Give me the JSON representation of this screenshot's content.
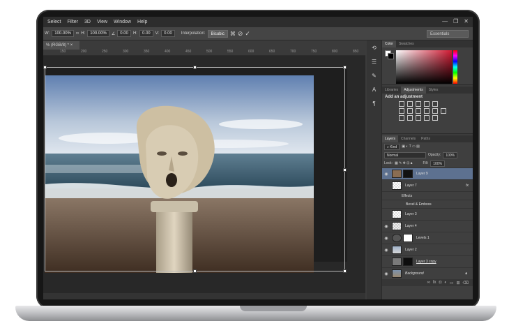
{
  "menubar": {
    "items": [
      "Select",
      "Filter",
      "3D",
      "View",
      "Window",
      "Help"
    ],
    "window_controls": [
      "—",
      "❐",
      "✕"
    ]
  },
  "options": {
    "w_label": "W:",
    "w_value": "100.00%",
    "h_label": "H:",
    "h_value": "100.00%",
    "angle_value": "0.00",
    "hskew_label": "H:",
    "hskew_value": "0.00",
    "vskew_label": "V:",
    "vskew_value": "0.00",
    "interp_label": "Interpolation:",
    "interp_value": "Bicubic",
    "workspace": "Essentials"
  },
  "document": {
    "tab_label": "% (RGB/8) *",
    "ruler_labels": [
      "150",
      "200",
      "250",
      "300",
      "350",
      "400",
      "450",
      "500",
      "550",
      "600",
      "650",
      "700",
      "750",
      "800",
      "850"
    ]
  },
  "panels": {
    "color_tabs": [
      "Color",
      "Swatches"
    ],
    "adjust_tabs": [
      "Libraries",
      "Adjustments",
      "Styles"
    ],
    "adjust_title": "Add an adjustment",
    "layers_tabs": [
      "Layers",
      "Channels",
      "Paths"
    ],
    "kind_label": "Kind",
    "blend_mode": "Normal",
    "opacity_label": "Opacity:",
    "opacity_value": "100%",
    "lock_label": "Lock:",
    "fill_label": "Fill:",
    "fill_value": "100%"
  },
  "layers": [
    {
      "name": "Layer 9",
      "selected": true,
      "thumb": "#8a6d52",
      "mask": "#111111"
    },
    {
      "name": "Layer 7",
      "selected": false,
      "thumb": "#d8d8d8",
      "fx": "fx"
    },
    {
      "name": "Effects",
      "selected": false,
      "sub": true
    },
    {
      "name": "Bevel & Emboss",
      "selected": false,
      "sub": true
    },
    {
      "name": "Layer 3",
      "selected": false,
      "thumb": "#dcdcdc"
    },
    {
      "name": "Layer 4",
      "selected": false,
      "thumb": "#cfcfcf"
    },
    {
      "name": "Levels 1",
      "selected": false,
      "thumb": "#ffffff"
    },
    {
      "name": "Layer 2",
      "selected": false,
      "thumb": "#c7c7c7"
    },
    {
      "name": "Layer 3 copy",
      "selected": false,
      "thumb": "#7a7a7a",
      "mask": "#0d0d0d"
    },
    {
      "name": "Background",
      "selected": false,
      "thumb": "#9a8870"
    }
  ],
  "colors": {
    "selection": "#5d7190",
    "panel_bg": "#3f3f3f",
    "canvas_bg": "#282828"
  }
}
